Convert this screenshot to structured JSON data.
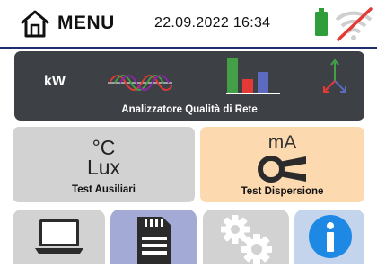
{
  "header": {
    "title": "MENU",
    "datetime": "22.09.2022  16:34",
    "home_icon": "home-icon",
    "battery_icon": "battery-icon",
    "signal_icon": "wifi-off-icon"
  },
  "analyzer": {
    "unit": "kW",
    "label": "Analizzatore Qualità di Rete",
    "icons": [
      "sine-wave-icon",
      "bar-chart-icon",
      "vector-diagram-icon"
    ]
  },
  "aux_test": {
    "unit_top": "°C",
    "unit_bottom": "Lux",
    "label": "Test Ausiliari"
  },
  "leakage_test": {
    "unit": "mA",
    "label": "Test Dispersione",
    "icon": "clamp-meter-icon"
  },
  "bottom_tiles": [
    {
      "icon": "laptop-icon"
    },
    {
      "icon": "memory-card-icon"
    },
    {
      "icon": "gears-icon"
    },
    {
      "icon": "info-icon"
    }
  ],
  "colors": {
    "panel": "#3d4045",
    "aux_tile": "#d2d2d2",
    "leakage_tile": "#fdd9b0",
    "memory_tile": "#a4aad6",
    "info_tile": "#c3d4ec",
    "battery": "#2e9d3a",
    "header_line": "#1f2e6e"
  }
}
